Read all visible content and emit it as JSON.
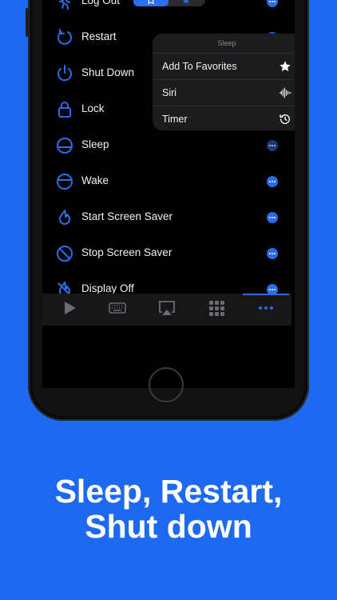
{
  "list": {
    "items": [
      {
        "label": "Log Out",
        "icon": "walking-person-icon"
      },
      {
        "label": "Restart",
        "icon": "restart-icon"
      },
      {
        "label": "Shut Down",
        "icon": "power-icon"
      },
      {
        "label": "Lock",
        "icon": "lock-icon"
      },
      {
        "label": "Sleep",
        "icon": "sleep-icon"
      },
      {
        "label": "Wake",
        "icon": "wake-icon"
      },
      {
        "label": "Start Screen Saver",
        "icon": "screen-saver-icon"
      },
      {
        "label": "Stop Screen Saver",
        "icon": "prohibited-icon"
      },
      {
        "label": "Display Off",
        "icon": "display-off-icon"
      }
    ]
  },
  "menu": {
    "title": "Sleep",
    "items": [
      {
        "label": "Add To Favorites",
        "icon": "star-icon"
      },
      {
        "label": "Siri",
        "icon": "siri-waveform-icon"
      },
      {
        "label": "Timer",
        "icon": "timer-icon"
      }
    ]
  },
  "tabbar": {
    "tabs": [
      {
        "icon": "play-icon"
      },
      {
        "icon": "keyboard-icon"
      },
      {
        "icon": "airplay-icon"
      },
      {
        "icon": "grid-icon"
      },
      {
        "icon": "more-icon",
        "selected": true
      }
    ]
  },
  "colors": {
    "accent": "#2b6de8",
    "background": "#1d6af0"
  },
  "headline": {
    "line1": "Sleep, Restart,",
    "line2": "Shut down"
  }
}
